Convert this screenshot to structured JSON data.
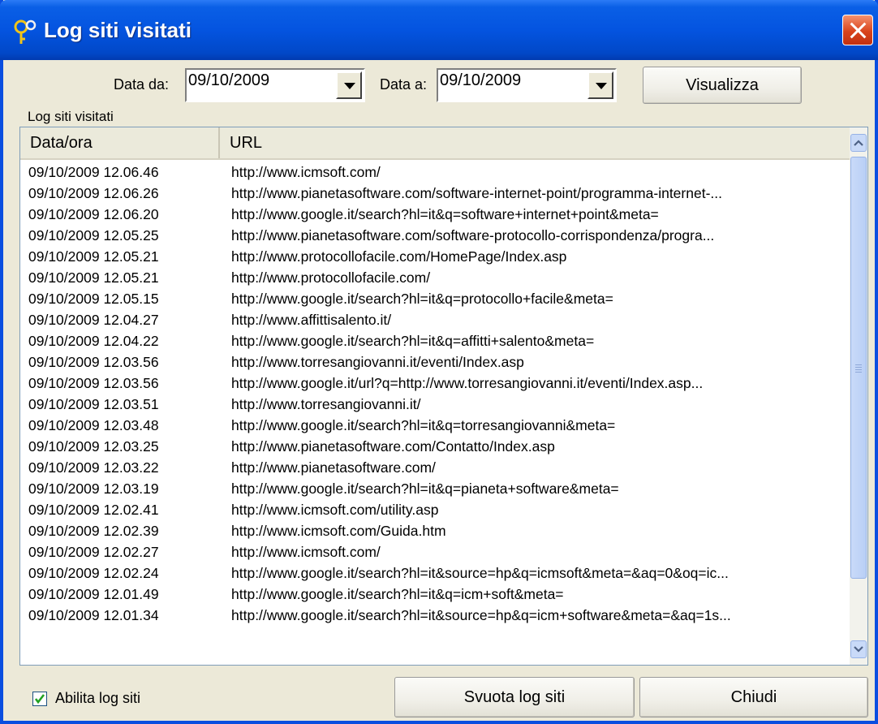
{
  "window": {
    "title": "Log siti visitati",
    "close_icon": "close-icon",
    "title_icon": "key-icon"
  },
  "filter": {
    "from_label": "Data da:",
    "from_value": "09/10/2009",
    "to_label": "Data a:",
    "to_value": "09/10/2009",
    "view_button": "Visualizza"
  },
  "list": {
    "group_label": "Log siti visitati",
    "columns": [
      "Data/ora",
      "URL"
    ],
    "rows": [
      [
        "09/10/2009 12.06.46",
        "http://www.icmsoft.com/"
      ],
      [
        "09/10/2009 12.06.26",
        "http://www.pianetasoftware.com/software-internet-point/programma-internet-..."
      ],
      [
        "09/10/2009 12.06.20",
        "http://www.google.it/search?hl=it&q=software+internet+point&meta="
      ],
      [
        "09/10/2009 12.05.25",
        "http://www.pianetasoftware.com/software-protocollo-corrispondenza/progra..."
      ],
      [
        "09/10/2009 12.05.21",
        "http://www.protocollofacile.com/HomePage/Index.asp"
      ],
      [
        "09/10/2009 12.05.21",
        "http://www.protocollofacile.com/"
      ],
      [
        "09/10/2009 12.05.15",
        "http://www.google.it/search?hl=it&q=protocollo+facile&meta="
      ],
      [
        "09/10/2009 12.04.27",
        "http://www.affittisalento.it/"
      ],
      [
        "09/10/2009 12.04.22",
        "http://www.google.it/search?hl=it&q=affitti+salento&meta="
      ],
      [
        "09/10/2009 12.03.56",
        "http://www.torresangiovanni.it/eventi/Index.asp"
      ],
      [
        "09/10/2009 12.03.56",
        "http://www.google.it/url?q=http://www.torresangiovanni.it/eventi/Index.asp..."
      ],
      [
        "09/10/2009 12.03.51",
        "http://www.torresangiovanni.it/"
      ],
      [
        "09/10/2009 12.03.48",
        "http://www.google.it/search?hl=it&q=torresangiovanni&meta="
      ],
      [
        "09/10/2009 12.03.25",
        "http://www.pianetasoftware.com/Contatto/Index.asp"
      ],
      [
        "09/10/2009 12.03.22",
        "http://www.pianetasoftware.com/"
      ],
      [
        "09/10/2009 12.03.19",
        "http://www.google.it/search?hl=it&q=pianeta+software&meta="
      ],
      [
        "09/10/2009 12.02.41",
        "http://www.icmsoft.com/utility.asp"
      ],
      [
        "09/10/2009 12.02.39",
        "http://www.icmsoft.com/Guida.htm"
      ],
      [
        "09/10/2009 12.02.27",
        "http://www.icmsoft.com/"
      ],
      [
        "09/10/2009 12.02.24",
        "http://www.google.it/search?hl=it&source=hp&q=icmsoft&meta=&aq=0&oq=ic..."
      ],
      [
        "09/10/2009 12.01.49",
        "http://www.google.it/search?hl=it&q=icm+soft&meta="
      ],
      [
        "09/10/2009 12.01.34",
        "http://www.google.it/search?hl=it&source=hp&q=icm+software&meta=&aq=1s..."
      ]
    ]
  },
  "footer": {
    "checkbox_label": "Abilita log siti",
    "checkbox_checked": true,
    "clear_button": "Svuota log siti",
    "close_button": "Chiudi"
  },
  "colors": {
    "titlebar": "#0454e0",
    "close_button": "#d9441c",
    "dialog_bg": "#ece9d8",
    "scrollbar": "#c9daf8"
  }
}
